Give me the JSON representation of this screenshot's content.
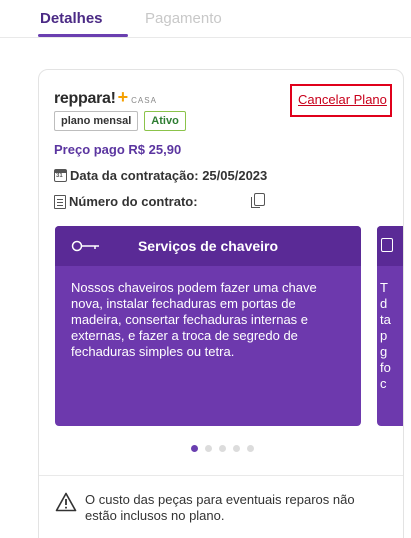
{
  "tabs": [
    {
      "label": "Detalhes",
      "active": true
    },
    {
      "label": "Pagamento",
      "active": false
    }
  ],
  "plan_card": {
    "brand_name": "reppara!",
    "brand_plus": "+",
    "brand_sub": "CASA",
    "cancel_label": "Cancelar Plano",
    "badge_plan": "plano mensal",
    "badge_status": "Ativo",
    "price_text": "Preço pago R$ 25,90",
    "date_label": "Data da contratação: 25/05/2023",
    "contract_label": "Número do contrato:",
    "calendar_day": "31"
  },
  "carousel": {
    "slides": [
      {
        "title": "Serviços de chaveiro",
        "icon": "key-icon",
        "text": "Nossos chaveiros podem fazer uma chave nova, instalar fechaduras em portas de madeira, consertar fechaduras internas e externas, e fazer a troca de segredo de fechaduras simples ou tetra."
      },
      {
        "title": "",
        "icon": "appliance-icon",
        "text_fragments": [
          "T",
          "d",
          "ta",
          "p",
          "g",
          "fo",
          "c"
        ]
      }
    ],
    "dot_count": 5,
    "active_dot": 0
  },
  "notice": {
    "icon": "warning-icon",
    "text": "O custo das peças para eventuais reparos não estão inclusos no plano."
  },
  "colors": {
    "brand_purple": "#6d39ad",
    "tab_active": "#4b2a85",
    "cancel_red": "#e0001b",
    "active_green": "#8bc34a",
    "brand_orange": "#f5a000"
  }
}
